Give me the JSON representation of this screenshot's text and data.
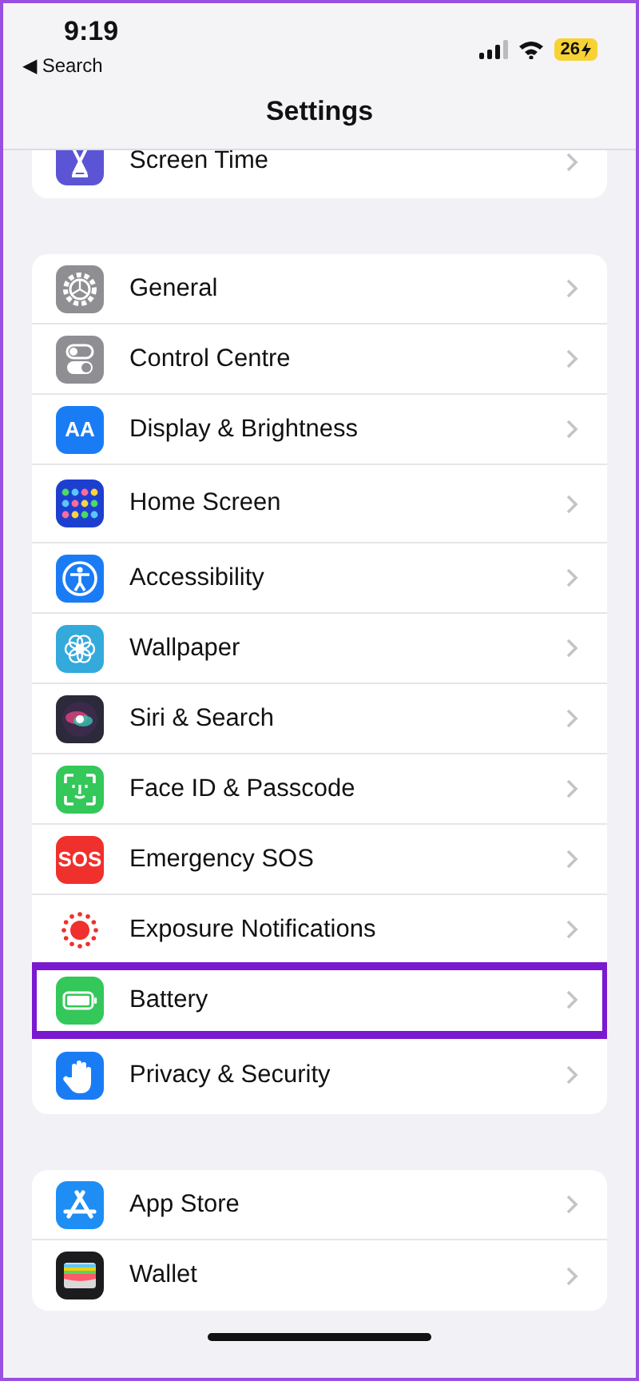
{
  "status_bar": {
    "time": "9:19",
    "back_arrow": "◀",
    "back_label": "Search",
    "battery": "26"
  },
  "nav": {
    "title": "Settings"
  },
  "groups": [
    {
      "partial": true,
      "items": [
        {
          "label": "Screen Time",
          "kind": "hourglass",
          "highlighted": false
        }
      ]
    },
    {
      "partial": false,
      "items": [
        {
          "label": "General",
          "kind": "gear",
          "highlighted": false
        },
        {
          "label": "Control Centre",
          "kind": "toggles",
          "highlighted": false
        },
        {
          "label": "Display & Brightness",
          "kind": "text",
          "icon_text": "AA",
          "highlighted": false
        },
        {
          "label": "Home Screen",
          "kind": "grid",
          "highlighted": false
        },
        {
          "label": "Accessibility",
          "kind": "accessibility",
          "highlighted": false
        },
        {
          "label": "Wallpaper",
          "kind": "flower",
          "highlighted": false
        },
        {
          "label": "Siri & Search",
          "kind": "siri",
          "highlighted": false
        },
        {
          "label": "Face ID & Passcode",
          "kind": "face",
          "highlighted": false
        },
        {
          "label": "Emergency SOS",
          "kind": "text",
          "icon_text": "SOS",
          "highlighted": false
        },
        {
          "label": "Exposure Notifications",
          "kind": "exposure",
          "highlighted": false
        },
        {
          "label": "Battery",
          "kind": "battery",
          "highlighted": true
        },
        {
          "label": "Privacy & Security",
          "kind": "hand",
          "highlighted": false
        }
      ]
    },
    {
      "partial": false,
      "items": [
        {
          "label": "App Store",
          "kind": "appstore",
          "highlighted": false
        },
        {
          "label": "Wallet",
          "kind": "wallet",
          "highlighted": false
        }
      ]
    }
  ]
}
